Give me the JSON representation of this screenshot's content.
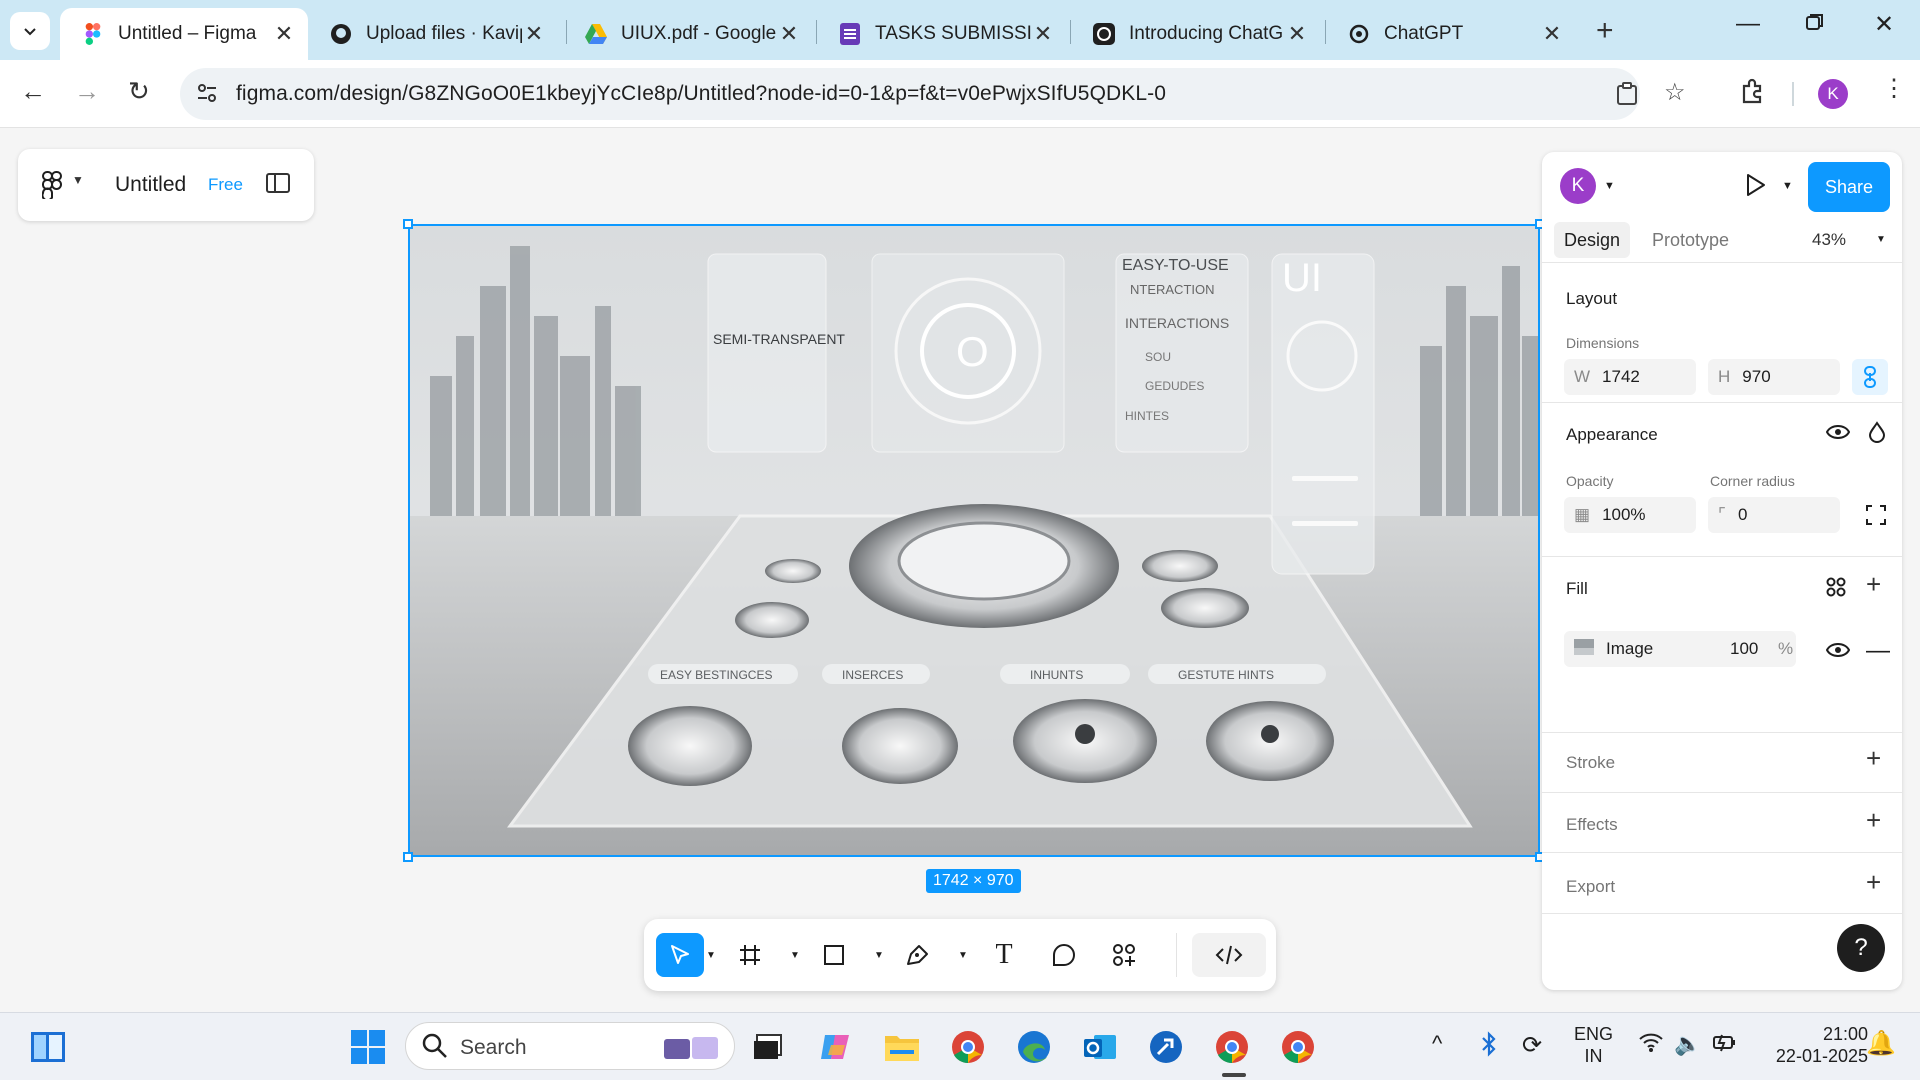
{
  "browser": {
    "tabs": [
      {
        "title": "Untitled – Figma",
        "icon": "figma-icon",
        "active": true
      },
      {
        "title": "Upload files · Kavip",
        "icon": "github-icon",
        "active": false
      },
      {
        "title": "UIUX.pdf - Google",
        "icon": "google-drive-icon",
        "active": false
      },
      {
        "title": "TASKS SUBMISSIO",
        "icon": "google-forms-icon",
        "active": false
      },
      {
        "title": "Introducing ChatG",
        "icon": "openai-icon",
        "active": false
      },
      {
        "title": "ChatGPT",
        "icon": "openai-icon",
        "active": false
      }
    ],
    "url": "figma.com/design/G8ZNGoO0E1kbeyjYcCIe8p/Untitled?node-id=0-1&p=f&t=v0ePwjxSIfU5QDKL-0",
    "profile_initial": "K"
  },
  "file": {
    "name": "Untitled",
    "plan": "Free"
  },
  "canvas": {
    "dimension_badge": "1742 × 970",
    "image_labels": {
      "semi": "SEMI-TRANSPAENT",
      "easy": "EASY-TO-USE",
      "interaction": "NTERACTION",
      "interactions": "INTERACTIONS",
      "sound": "SOU",
      "gestures": "GEDUDES",
      "hints": "HINTES",
      "ui": "UI",
      "bottom_labels": [
        "EASY BESTINGCES",
        "INSERCES",
        "INHUNTS",
        "GESTUTE HINTS"
      ]
    }
  },
  "panel": {
    "avatar_initial": "K",
    "share_label": "Share",
    "tabs": {
      "design": "Design",
      "prototype": "Prototype"
    },
    "zoom": "43%",
    "layout": {
      "title": "Layout",
      "dimensions_label": "Dimensions",
      "w_label": "W",
      "w_value": "1742",
      "h_label": "H",
      "h_value": "970"
    },
    "appearance": {
      "title": "Appearance",
      "opacity_label": "Opacity",
      "opacity_value": "100%",
      "radius_label": "Corner radius",
      "radius_value": "0"
    },
    "fill": {
      "title": "Fill",
      "type": "Image",
      "opacity": "100",
      "unit": "%"
    },
    "stroke_title": "Stroke",
    "effects_title": "Effects",
    "export_title": "Export",
    "help": "?"
  },
  "taskbar": {
    "search_label": "Search",
    "lang_top": "ENG",
    "lang_bottom": "IN",
    "time": "21:00",
    "date": "22-01-2025"
  },
  "colors": {
    "accent": "#0d99ff",
    "avatar": "#9b3dc9",
    "tabstrip": "#cde8f5"
  }
}
